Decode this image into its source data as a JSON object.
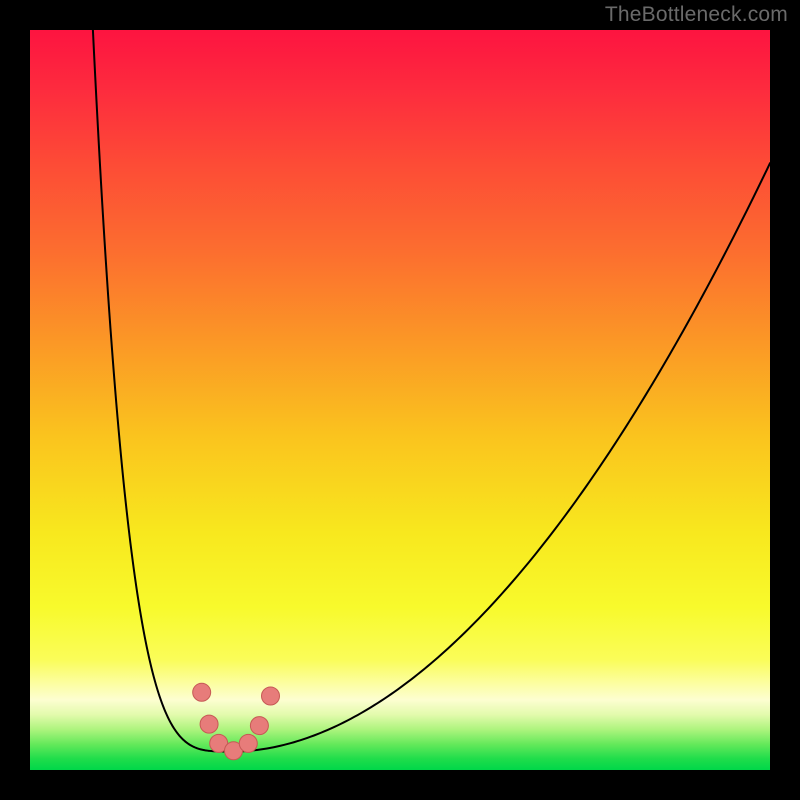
{
  "watermark": {
    "text": "TheBottleneck.com"
  },
  "colors": {
    "bg": "#000000",
    "curve": "#000000",
    "marker_fill": "#e77c7a",
    "marker_stroke": "#c65955",
    "grad_stops": [
      {
        "offset": 0.0,
        "color": "#fd1440"
      },
      {
        "offset": 0.08,
        "color": "#fd2b3e"
      },
      {
        "offset": 0.18,
        "color": "#fd4b36"
      },
      {
        "offset": 0.3,
        "color": "#fc6e2f"
      },
      {
        "offset": 0.42,
        "color": "#fb9726"
      },
      {
        "offset": 0.55,
        "color": "#fac41e"
      },
      {
        "offset": 0.68,
        "color": "#f8e81e"
      },
      {
        "offset": 0.78,
        "color": "#f8fa2c"
      },
      {
        "offset": 0.85,
        "color": "#fafd58"
      },
      {
        "offset": 0.905,
        "color": "#fdfed1"
      },
      {
        "offset": 0.925,
        "color": "#e3fbad"
      },
      {
        "offset": 0.945,
        "color": "#aef47e"
      },
      {
        "offset": 0.965,
        "color": "#65e95b"
      },
      {
        "offset": 0.985,
        "color": "#1fdd4b"
      },
      {
        "offset": 1.0,
        "color": "#00d749"
      }
    ]
  },
  "chart_data": {
    "type": "line",
    "title": "",
    "xlabel": "",
    "ylabel": "",
    "xlim": [
      0,
      100
    ],
    "ylim": [
      0,
      100
    ],
    "curve": {
      "min_x": 27.5,
      "min_y": 2.5,
      "left_top_x": 8.5,
      "left_top_y": 100,
      "right_top_x": 100,
      "right_top_y": 82,
      "left_gamma": 4.0,
      "right_gamma": 1.9
    },
    "markers": [
      {
        "x": 23.2,
        "y": 10.5
      },
      {
        "x": 24.2,
        "y": 6.2
      },
      {
        "x": 25.5,
        "y": 3.6
      },
      {
        "x": 27.5,
        "y": 2.6
      },
      {
        "x": 29.5,
        "y": 3.6
      },
      {
        "x": 31.0,
        "y": 6.0
      },
      {
        "x": 32.5,
        "y": 10.0
      }
    ],
    "marker_radius": 9
  }
}
